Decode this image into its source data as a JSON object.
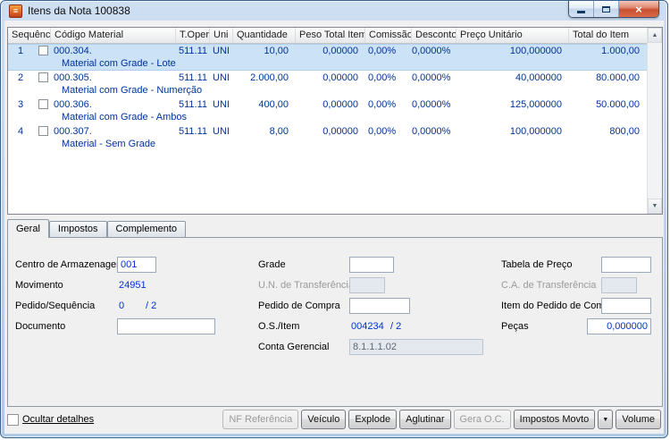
{
  "window": {
    "title": "Itens da Nota 100838"
  },
  "icons": {
    "close": "×",
    "window_glyph": "≡",
    "dropdown_arrow": "▼",
    "scroll_up": "▲",
    "scroll_down": "▼"
  },
  "grid": {
    "columns": [
      "Sequência",
      "Código Material",
      "T.Oper.",
      "Uni",
      "Quantidade",
      "Peso Total Item",
      "Comissão",
      "Desconto",
      "Preço Unitário",
      "Total do Item"
    ],
    "rows": [
      {
        "seq": "1",
        "codigo": "000.304.",
        "descricao": "Material com Grade - Lote",
        "toper": "511.11",
        "uni": "UNI",
        "quantidade": "10,00",
        "peso": "0,00000",
        "comissao": "0,00%",
        "desconto": "0,0000%",
        "preco": "100,000000",
        "total": "1.000,00"
      },
      {
        "seq": "2",
        "codigo": "000.305.",
        "descricao": "Material com Grade - Numerção",
        "toper": "511.11",
        "uni": "UNI",
        "quantidade": "2.000,00",
        "peso": "0,00000",
        "comissao": "0,00%",
        "desconto": "0,0000%",
        "preco": "40,000000",
        "total": "80.000,00"
      },
      {
        "seq": "3",
        "codigo": "000.306.",
        "descricao": "Material com Grade - Ambos",
        "toper": "511.11",
        "uni": "UNI",
        "quantidade": "400,00",
        "peso": "0,00000",
        "comissao": "0,00%",
        "desconto": "0,0000%",
        "preco": "125,000000",
        "total": "50.000,00"
      },
      {
        "seq": "4",
        "codigo": "000.307.",
        "descricao": "Material - Sem Grade",
        "toper": "511.11",
        "uni": "UNI",
        "quantidade": "8,00",
        "peso": "0,00000",
        "comissao": "0,00%",
        "desconto": "0,0000%",
        "preco": "100,000000",
        "total": "800,00"
      }
    ]
  },
  "tabs": [
    {
      "label": "Geral",
      "active": true
    },
    {
      "label": "Impostos",
      "active": false
    },
    {
      "label": "Complemento",
      "active": false
    }
  ],
  "form": {
    "centro_armazenagem": {
      "label": "Centro de Armazenagem",
      "value": "001"
    },
    "movimento": {
      "label": "Movimento",
      "value": "24951"
    },
    "pedido_sequencia": {
      "label": "Pedido/Sequência",
      "value": "0",
      "suffix": "/ 2"
    },
    "documento": {
      "label": "Documento",
      "value": ""
    },
    "grade": {
      "label": "Grade",
      "value": ""
    },
    "un_transferencia": {
      "label": "U.N. de Transferência",
      "value": ""
    },
    "pedido_compra": {
      "label": "Pedido de Compra",
      "value": ""
    },
    "os_item": {
      "label": "O.S./Item",
      "value": "004234",
      "suffix": "/ 2"
    },
    "conta_gerencial": {
      "label": "Conta Gerencial",
      "value": "8.1.1.1.02"
    },
    "tabela_preco": {
      "label": "Tabela de Preço",
      "value": ""
    },
    "ca_transferencia": {
      "label": "C.A. de Transferência",
      "value": ""
    },
    "item_pedido_compra": {
      "label": "Item do Pedido de Compra",
      "value": ""
    },
    "pecas": {
      "label": "Peças",
      "value": "0,000000"
    }
  },
  "footer": {
    "hide_details_label": "Ocultar detalhes",
    "buttons": {
      "nf_referencia": "NF Referência",
      "veiculo": "Veículo",
      "explode": "Explode",
      "aglutinar": "Aglutinar",
      "gera_oc": "Gera O.C.",
      "impostos_movto": "Impostos Movto",
      "volume": "Volume"
    }
  },
  "colors": {
    "selection_bg": "#cbe2f7",
    "grid_text": "#003399",
    "value_text": "#0033cc",
    "close_button": "#c94f2f"
  }
}
